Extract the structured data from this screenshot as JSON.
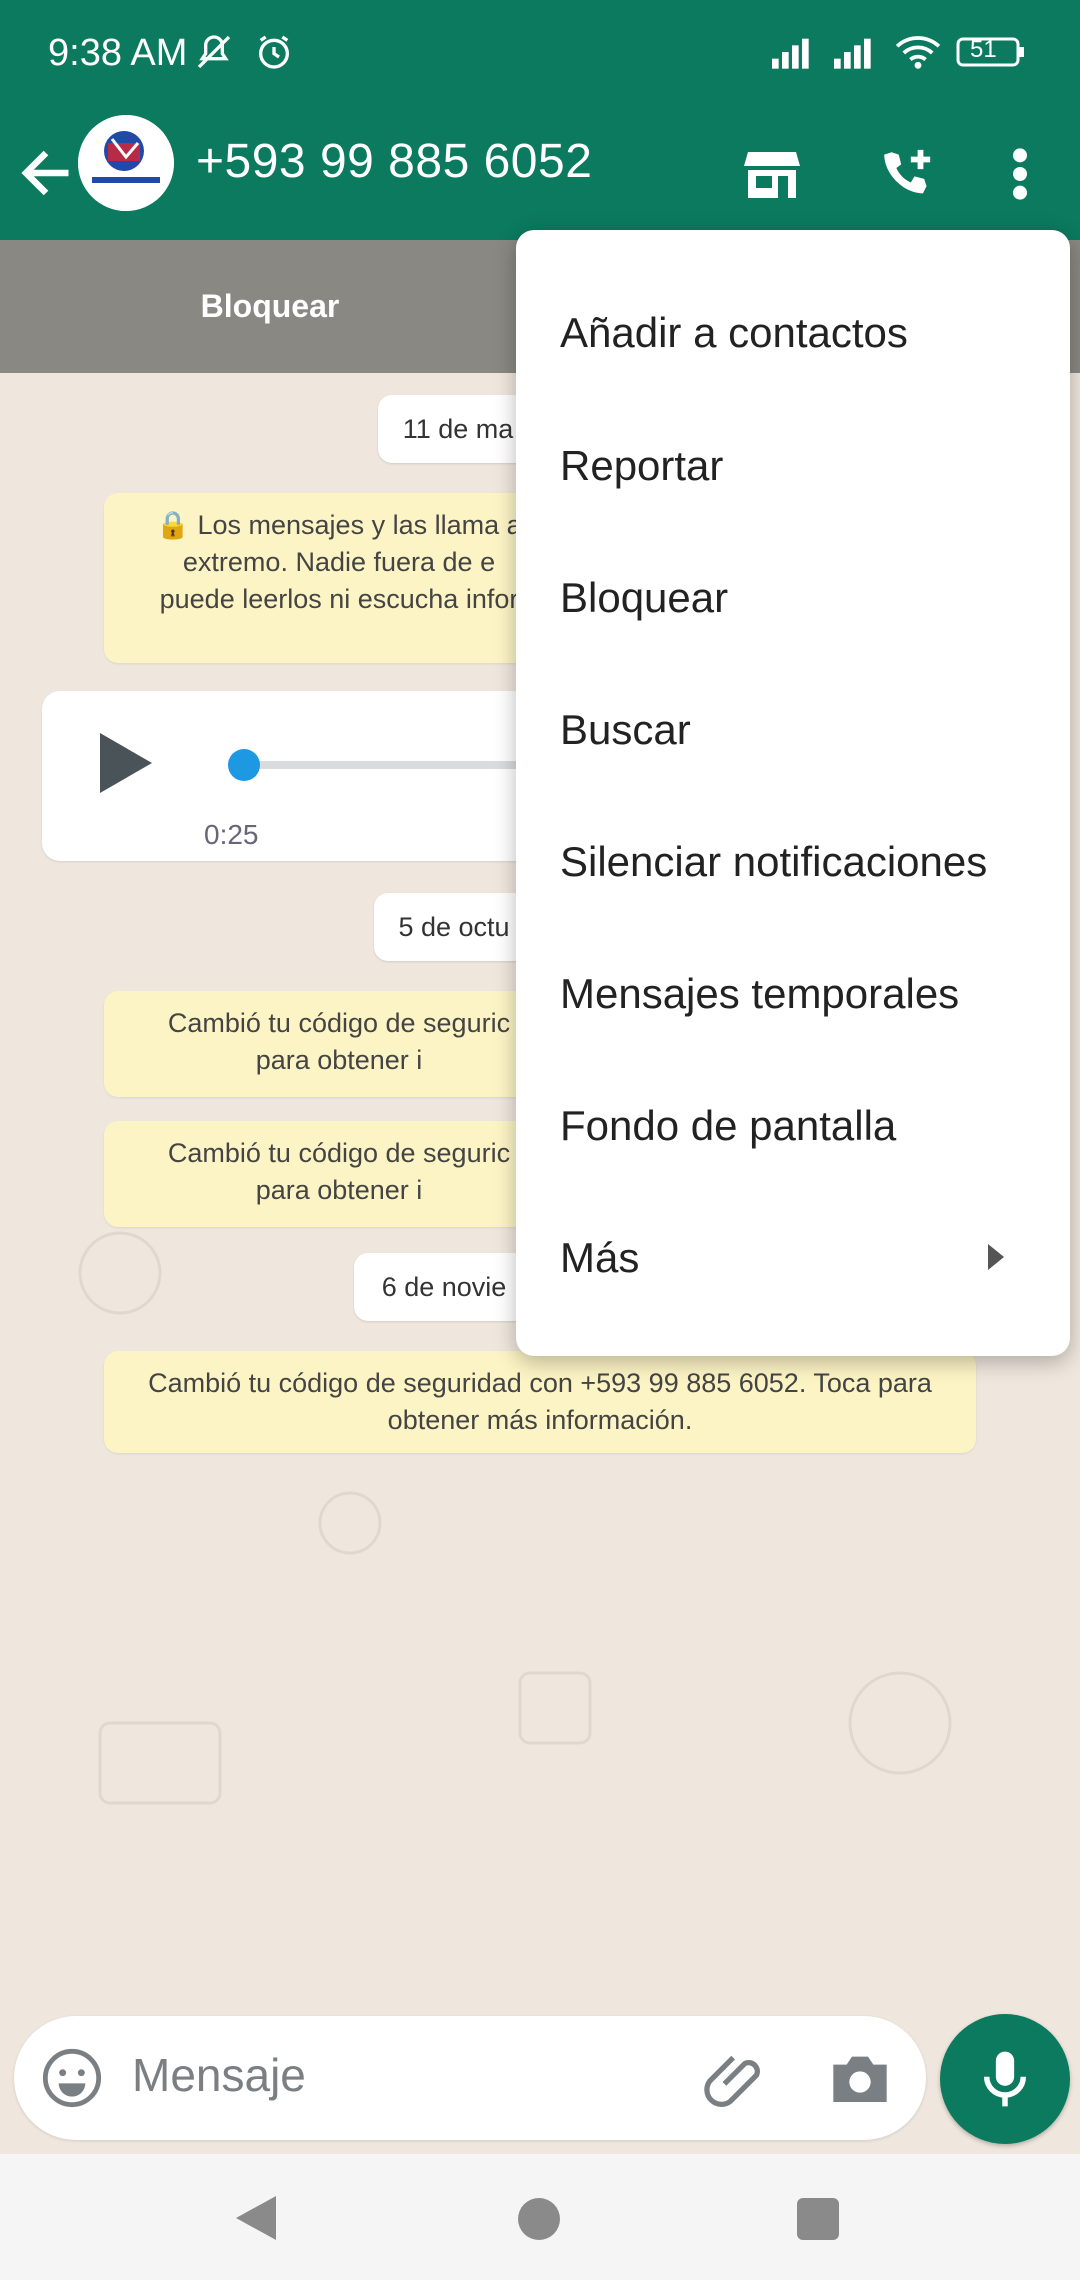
{
  "status_bar": {
    "time": "9:38 AM",
    "battery": "51",
    "icons": [
      "mute-icon",
      "alarm-icon",
      "signal-icon",
      "signal-icon",
      "wifi-icon",
      "battery-icon"
    ]
  },
  "header": {
    "contact_name": "+593 99 885 6052",
    "avatar_icon": "avatar-logo",
    "icons": [
      "back-arrow-icon",
      "store-icon",
      "add-call-icon",
      "more-vert-icon"
    ]
  },
  "action_bar": {
    "block_label": "Bloquear"
  },
  "chat": {
    "date1": "11 de ma",
    "encryption_notice": "🔒 Los mensajes y las llama a extremo. Nadie fuera de e puede leerlos ni escucha infor",
    "voice_note": {
      "duration": "0:25",
      "progress": 0
    },
    "date2": "5 de octu",
    "security1": "Cambió tu código de seguric para obtener i",
    "security2": "Cambió tu código de seguric para obtener i",
    "date3": "6 de novie",
    "security3": "Cambió tu código de seguridad con +593 99 885 6052. Toca para obtener más información."
  },
  "menu": {
    "items": [
      {
        "label": "Añadir a contactos"
      },
      {
        "label": "Reportar"
      },
      {
        "label": "Bloquear"
      },
      {
        "label": "Buscar"
      },
      {
        "label": "Silenciar notificaciones"
      },
      {
        "label": "Mensajes temporales"
      },
      {
        "label": "Fondo de pantalla"
      },
      {
        "label": "Más"
      }
    ]
  },
  "input": {
    "placeholder": "Mensaje",
    "icons": [
      "emoji-icon",
      "attach-icon",
      "camera-icon",
      "mic-icon"
    ]
  },
  "colors": {
    "primary": "#0b7a5f",
    "chat_bg": "#efe7dd",
    "system_msg": "#fdf4c5",
    "accent_blue": "#1d98e3"
  }
}
